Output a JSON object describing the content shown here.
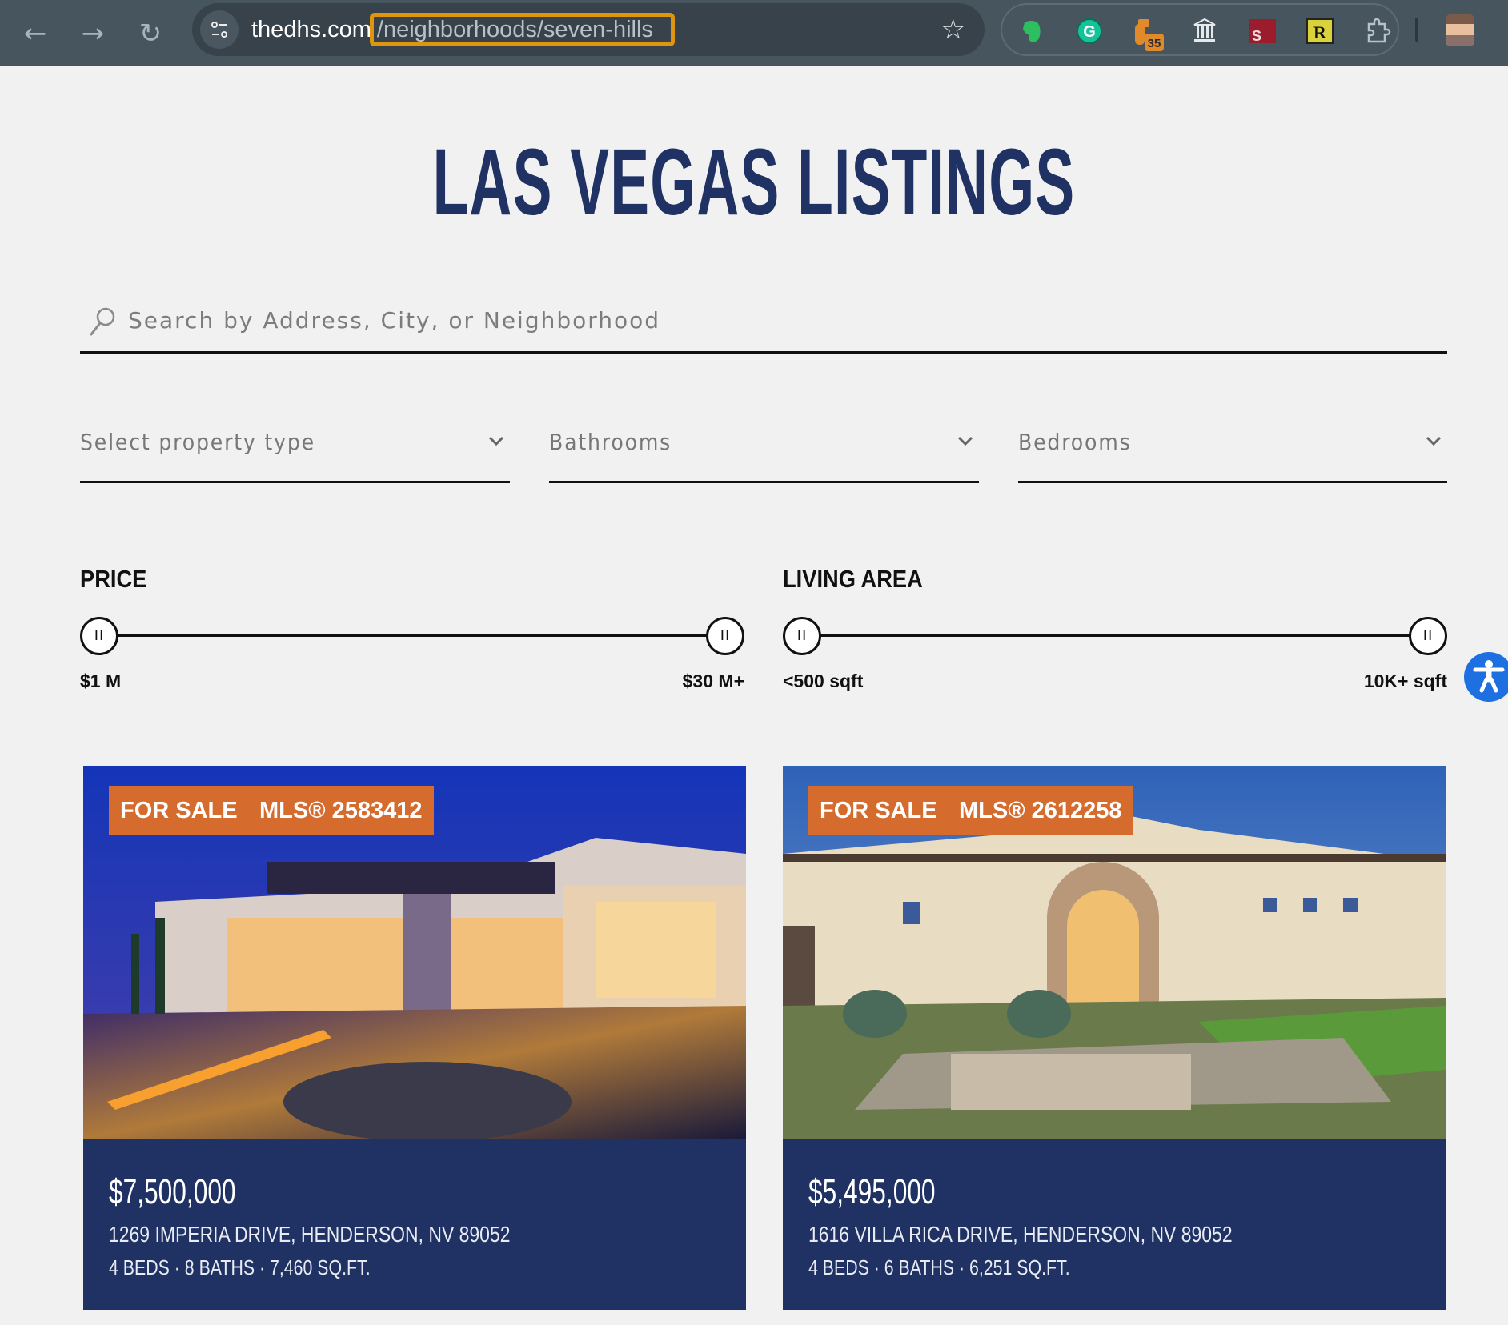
{
  "browser": {
    "back_icon": "←",
    "forward_icon": "→",
    "reload_icon": "↻",
    "site_info_icon": "⚙",
    "url_domain": "thedhs.com",
    "url_path": "/neighborhoods/seven-hills",
    "bookmark_icon": "☆",
    "extensions": [
      {
        "name": "evernote",
        "glyph": "🐘",
        "color": "#2dbe60"
      },
      {
        "name": "grammarly",
        "glyph": "G",
        "color": "#15c39a"
      },
      {
        "name": "badge-extension",
        "glyph": "35",
        "color": "#e08a2c"
      },
      {
        "name": "library",
        "glyph": "🏛",
        "color": "#e6e9ec"
      },
      {
        "name": "s-extension",
        "glyph": "S",
        "color": "#9b1c2c"
      },
      {
        "name": "r-extension",
        "glyph": "R",
        "color": "#d9d23a"
      },
      {
        "name": "extensions-puzzle",
        "glyph": "🧩",
        "color": "#b8c1c8"
      }
    ]
  },
  "page": {
    "title": "LAS VEGAS LISTINGS",
    "search": {
      "placeholder": "Search by Address, City, or Neighborhood",
      "value": ""
    },
    "filters": [
      {
        "label": "Select property type"
      },
      {
        "label": "Bathrooms"
      },
      {
        "label": "Bedrooms"
      }
    ],
    "ranges": {
      "price": {
        "title": "PRICE",
        "min_label": "$1 M",
        "max_label": "$30 M+",
        "min_fraction": 0,
        "max_fraction": 1
      },
      "living_area": {
        "title": "LIVING AREA",
        "min_label": "<500 sqft",
        "max_label": "10K+ sqft",
        "min_fraction": 0,
        "max_fraction": 1
      }
    },
    "handle_glyph": "II",
    "accessibility_label": "Accessibility"
  },
  "listings": [
    {
      "status": "FOR SALE",
      "mls": "MLS® 2583412",
      "price": "$7,500,000",
      "address": "1269 IMPERIA DRIVE, HENDERSON, NV 89052",
      "specs": "4 BEDS · 8 BATHS · 7,460 SQ.FT."
    },
    {
      "status": "FOR SALE",
      "mls": "MLS® 2612258",
      "price": "$5,495,000",
      "address": "1616 VILLA RICA DRIVE, HENDERSON, NV 89052",
      "specs": "4 BEDS · 6 BATHS · 6,251 SQ.FT."
    }
  ],
  "colors": {
    "brand_navy": "#1f3263",
    "badge_orange": "#d56b2c",
    "accessibility_blue": "#1e6fe0",
    "url_highlight": "#e0950e"
  }
}
